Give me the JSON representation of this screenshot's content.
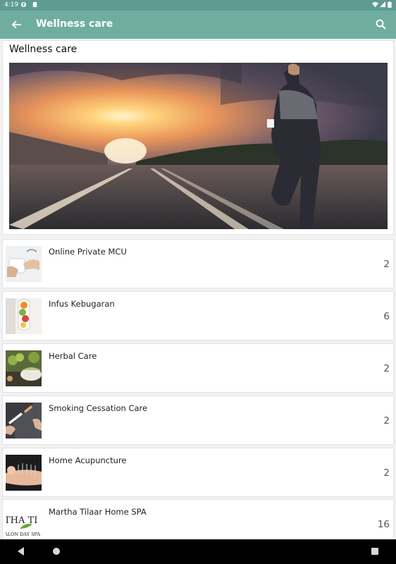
{
  "status_bar": {
    "time": "4:19"
  },
  "app_bar": {
    "title": "Wellness care"
  },
  "header_card": {
    "title": "Wellness care"
  },
  "items": [
    {
      "label": "Online Private MCU",
      "count": "2"
    },
    {
      "label": "Infus Kebugaran",
      "count": "6"
    },
    {
      "label": "Herbal Care",
      "count": "2"
    },
    {
      "label": "Smoking Cessation Care",
      "count": "2"
    },
    {
      "label": "Home Acupuncture",
      "count": "2"
    },
    {
      "label": "Martha Tilaar Home SPA",
      "count": "16",
      "logo_text_1": "THA TI",
      "logo_text_2": "ALON DAY SPA"
    }
  ],
  "colors": {
    "status_bar": "#5e9c91",
    "app_bar": "#6fada1"
  }
}
